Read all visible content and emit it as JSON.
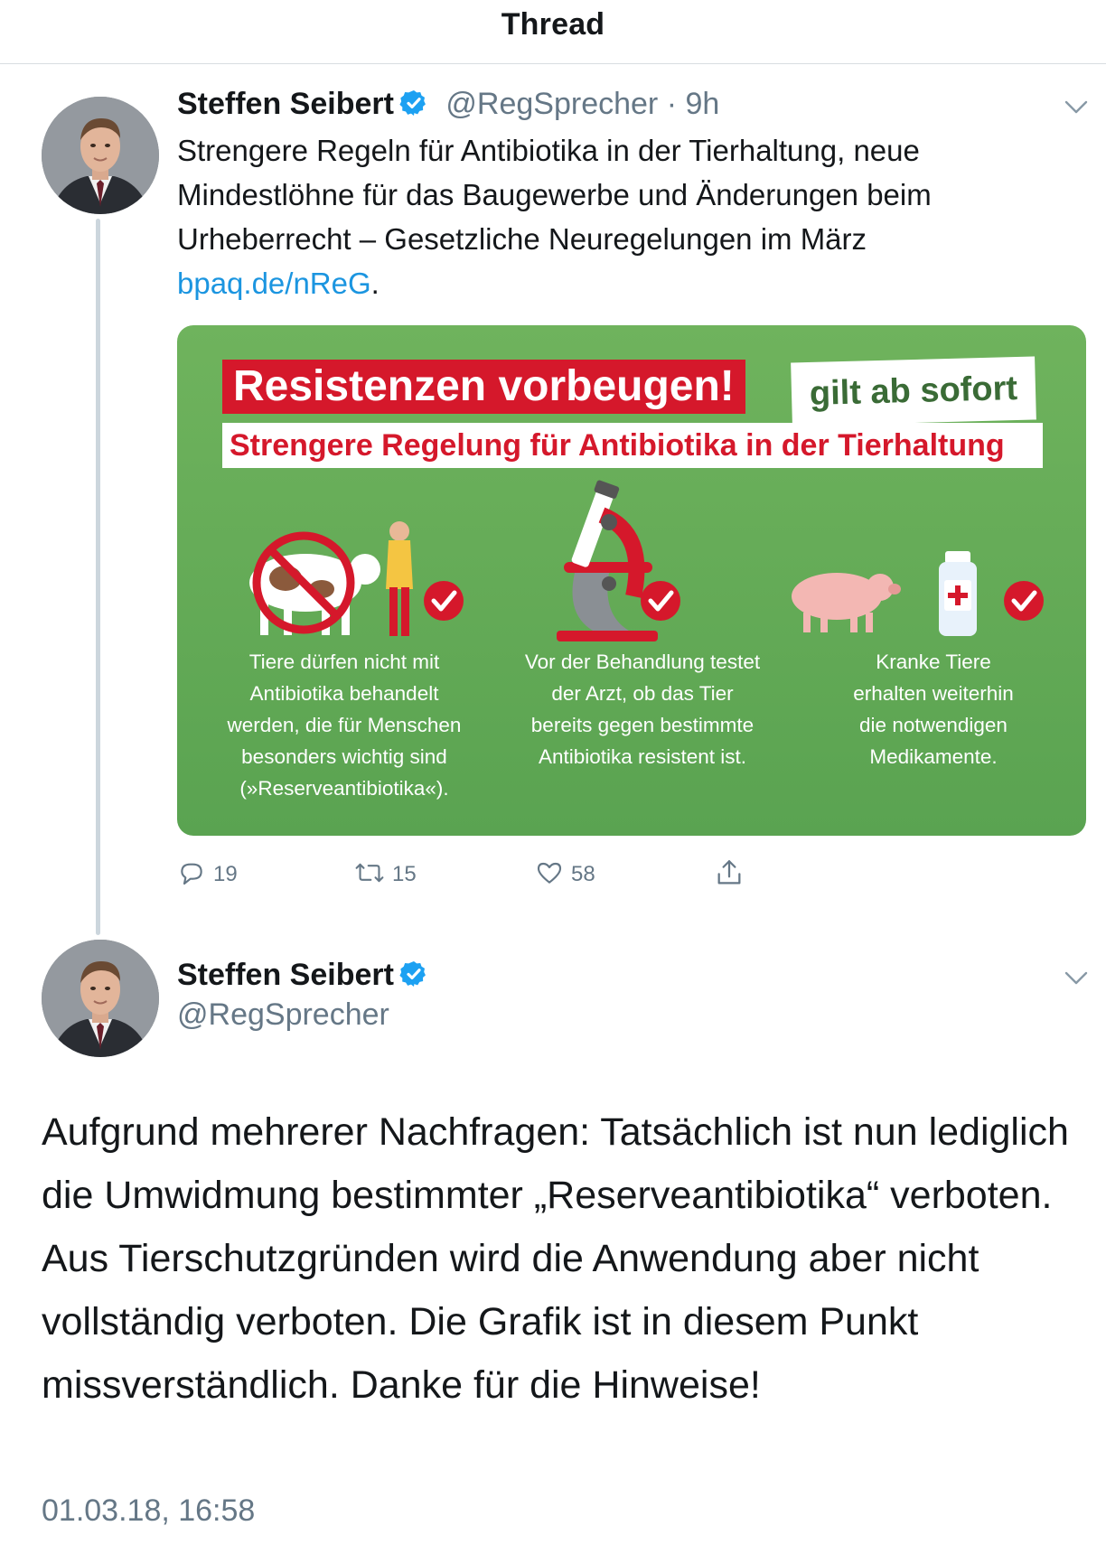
{
  "header": {
    "title": "Thread"
  },
  "tweet1": {
    "author_name": "Steffen Seibert",
    "handle": "@RegSprecher",
    "separator": " · ",
    "age": "9h",
    "text": "Strengere Regeln für Antibiotika in der Tierhaltung, neue Mindestlöhne für das Baugewerbe und Änderungen beim Urheberrecht – Gesetzliche Neuregelungen im März ",
    "link": "bpaq.de/nReG",
    "text_end": ".",
    "media": {
      "headline": "Resistenzen vorbeugen!",
      "stamp": "gilt ab sofort",
      "subline": "Strengere Regelung für Antibiotika in der Tierhaltung",
      "columns": [
        {
          "text": "Tiere dürfen nicht mit Antibiotika behandelt werden, die für Menschen besonders wichtig sind (»Reserveantibiotika«)."
        },
        {
          "text": "Vor der Behandlung testet der Arzt, ob das Tier bereits gegen bestimmte Antibiotika resistent ist."
        },
        {
          "text": "Kranke Tiere erhalten weiterhin die notwendigen Medikamente."
        }
      ]
    },
    "actions": {
      "replies": "19",
      "retweets": "15",
      "likes": "58"
    }
  },
  "tweet2": {
    "author_name": "Steffen Seibert",
    "handle": "@RegSprecher",
    "text": "Aufgrund mehrerer Nachfragen: Tatsächlich ist nun lediglich die Umwidmung bestimmter „Reserveantibiotika“ verboten. Aus Tierschutzgründen wird die Anwendung aber nicht vollständig verboten. Die Grafik ist in diesem Punkt missverständlich. Danke für die Hinweise!",
    "timestamp": "01.03.18, 16:58"
  },
  "colors": {
    "link": "#1b95e0",
    "verified": "#1da1f2",
    "muted": "#657786",
    "graphic_green": "#5aa351",
    "graphic_red": "#d5182b"
  },
  "icons": [
    "verified-badge-icon",
    "chevron-down-icon",
    "reply-icon",
    "retweet-icon",
    "like-icon",
    "share-icon"
  ]
}
